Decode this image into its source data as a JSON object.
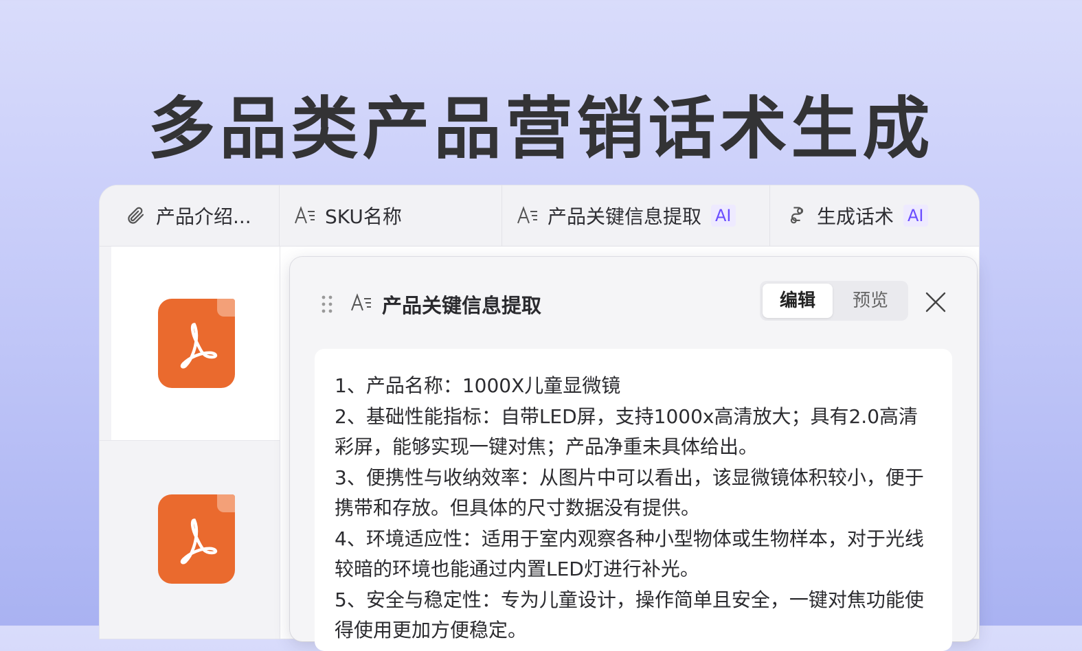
{
  "hero": {
    "title": "多品类产品营销话术生成"
  },
  "table": {
    "columns": [
      {
        "label": "产品介绍...",
        "icon": "paperclip-icon",
        "ai": ""
      },
      {
        "label": "SKU名称",
        "icon": "text-field-icon",
        "ai": ""
      },
      {
        "label": "产品关键信息提取",
        "icon": "text-field-icon",
        "ai": "AI"
      },
      {
        "label": "生成话术",
        "icon": "ai-generate-icon",
        "ai": "AI"
      }
    ],
    "attachments": [
      {
        "type": "pdf-icon"
      },
      {
        "type": "pdf-icon"
      }
    ]
  },
  "popup": {
    "title": "产品关键信息提取",
    "tabs": {
      "edit": "编辑",
      "preview": "预览"
    },
    "content": [
      "1、产品名称：1000X儿童显微镜",
      "2、基础性能指标：自带LED屏，支持1000x高清放大；具有2.0高清彩屏，能够实现一键对焦；产品净重未具体给出。",
      "3、便携性与收纳效率：从图片中可以看出，该显微镜体积较小，便于携带和存放。但具体的尺寸数据没有提供。",
      "4、环境适应性：适用于室内观察各种小型物体或生物样本，对于光线较暗的环境也能通过内置LED灯进行补光。",
      "5、安全与稳定性：专为儿童设计，操作简单且安全，一键对焦功能使得使用更加方便稳定。"
    ]
  },
  "colors": {
    "accent_ai": "#6a4dff",
    "pdf": "#ea6a2e"
  }
}
